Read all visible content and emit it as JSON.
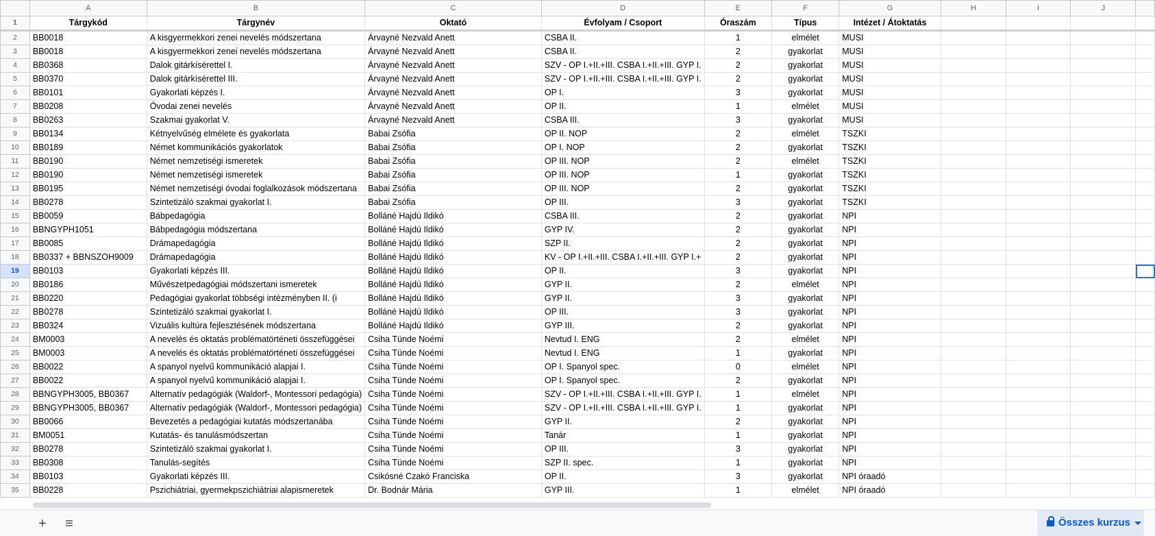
{
  "columns": [
    "A",
    "B",
    "C",
    "D",
    "E",
    "F",
    "G",
    "H",
    "I",
    "J"
  ],
  "header_row": {
    "row": "1",
    "cells": [
      "Tárgykód",
      "Tárgynév",
      "Oktató",
      "Évfolyam / Csoport",
      "Óraszám",
      "Típus",
      "Intézet / Átoktatás"
    ]
  },
  "rows": [
    {
      "n": "2",
      "cells": [
        "BB0018",
        "A kisgyermekkori zenei nevelés módszertana",
        "Árvayné Nezvald Anett",
        "CSBA II.",
        "1",
        "elmélet",
        "MUSI"
      ]
    },
    {
      "n": "3",
      "cells": [
        "BB0018",
        "A kisgyermekkori zenei nevelés módszertana",
        "Árvayné Nezvald Anett",
        "CSBA II.",
        "2",
        "gyakorlat",
        "MUSI"
      ]
    },
    {
      "n": "4",
      "cells": [
        "BB0368",
        "Dalok gitárkísérettel I.",
        "Árvayné Nezvald Anett",
        "SZV - OP I.+II.+III. CSBA I.+II.+III. GYP I.",
        "2",
        "gyakorlat",
        "MUSI"
      ]
    },
    {
      "n": "5",
      "cells": [
        "BB0370",
        "Dalok gitárkísérettel III.",
        "Árvayné Nezvald Anett",
        "SZV - OP I.+II.+III. CSBA I.+II.+III. GYP I.",
        "2",
        "gyakorlat",
        "MUSI"
      ]
    },
    {
      "n": "6",
      "cells": [
        "BB0101",
        "Gyakorlati képzés I.",
        "Árvayné Nezvald Anett",
        "OP I.",
        "3",
        "gyakorlat",
        "MUSI"
      ]
    },
    {
      "n": "7",
      "cells": [
        "BB0208",
        "Óvodai zenei nevelés",
        "Árvayné Nezvald Anett",
        "OP II.",
        "1",
        "elmélet",
        "MUSI"
      ]
    },
    {
      "n": "8",
      "cells": [
        "BB0263",
        "Szakmai gyakorlat V.",
        "Árvayné Nezvald Anett",
        "CSBA III.",
        "3",
        "gyakorlat",
        "MUSI"
      ]
    },
    {
      "n": "9",
      "cells": [
        "BB0134",
        "Kétnyelvűség elmélete és gyakorlata",
        "Babai Zsófia",
        "OP II. NOP",
        "2",
        "elmélet",
        "TSZKI"
      ]
    },
    {
      "n": "10",
      "cells": [
        "BB0189",
        "Német kommunikációs gyakorlatok",
        "Babai Zsófia",
        "OP I. NOP",
        "2",
        "gyakorlat",
        "TSZKI"
      ]
    },
    {
      "n": "11",
      "cells": [
        "BB0190",
        "Német nemzetiségi ismeretek",
        "Babai Zsófia",
        "OP III. NOP",
        "2",
        "elmélet",
        "TSZKI"
      ]
    },
    {
      "n": "12",
      "cells": [
        "BB0190",
        "Német nemzetiségi ismeretek",
        "Babai Zsófia",
        "OP III. NOP",
        "1",
        "gyakorlat",
        "TSZKI"
      ]
    },
    {
      "n": "13",
      "cells": [
        "BB0195",
        "Német nemzetiségi óvodai foglalkozások módszertana",
        "Babai Zsófia",
        "OP III. NOP",
        "2",
        "gyakorlat",
        "TSZKI"
      ]
    },
    {
      "n": "14",
      "cells": [
        "BB0278",
        "Szintetizáló szakmai gyakorlat I.",
        "Babai Zsófia",
        "OP III.",
        "3",
        "gyakorlat",
        "TSZKI"
      ]
    },
    {
      "n": "15",
      "cells": [
        "BB0059",
        "Bábpedagógia",
        "Bolláné Hajdú Ildikó",
        "CSBA III.",
        "2",
        "gyakorlat",
        "NPI"
      ]
    },
    {
      "n": "16",
      "cells": [
        "BBNGYPH1051",
        "Bábpedagógia módszertana",
        "Bolláné Hajdú Ildikó",
        "GYP IV.",
        "2",
        "gyakorlat",
        "NPI"
      ]
    },
    {
      "n": "17",
      "cells": [
        "BB0085",
        "Drámapedagógia",
        "Bolláné Hajdú Ildikó",
        "SZP II.",
        "2",
        "gyakorlat",
        "NPI"
      ]
    },
    {
      "n": "18",
      "cells": [
        "BB0337 + BBNSZOH9009",
        "Drámapedagógia",
        "Bolláné Hajdú Ildikó",
        "KV - OP I.+II.+III. CSBA I.+II.+III. GYP I.+",
        "2",
        "gyakorlat",
        "NPI"
      ]
    },
    {
      "n": "19",
      "cells": [
        "BB0103",
        "Gyakorlati képzés III.",
        "Bolláné Hajdú Ildikó",
        "OP II.",
        "3",
        "gyakorlat",
        "NPI"
      ]
    },
    {
      "n": "20",
      "cells": [
        "BB0186",
        "Művészetpedagógiai módszertani ismeretek",
        "Bolláné Hajdú Ildikó",
        "GYP II.",
        "2",
        "elmélet",
        "NPI"
      ]
    },
    {
      "n": "21",
      "cells": [
        "BB0220",
        "Pedagógiai gyakorlat többségi intézményben II. (i",
        "Bolláné Hajdú Ildikó",
        "GYP II.",
        "3",
        "gyakorlat",
        "NPI"
      ]
    },
    {
      "n": "22",
      "cells": [
        "BB0278",
        "Szintetizáló szakmai gyakorlat I.",
        "Bolláné Hajdú Ildikó",
        "OP III.",
        "3",
        "gyakorlat",
        "NPI"
      ]
    },
    {
      "n": "23",
      "cells": [
        "BB0324",
        "Vizuális kultúra fejlesztésének módszertana",
        "Bolláné Hajdú Ildikó",
        "GYP III.",
        "2",
        "gyakorlat",
        "NPI"
      ]
    },
    {
      "n": "24",
      "cells": [
        "BM0003",
        "A nevelés és oktatás problématörténeti összefüggései",
        "Csiha Tünde Noémi",
        "Nevtud I. ENG",
        "2",
        "elmélet",
        "NPI"
      ]
    },
    {
      "n": "25",
      "cells": [
        "BM0003",
        "A nevelés és oktatás problématörténeti összefüggései",
        "Csiha Tünde Noémi",
        "Nevtud I. ENG",
        "1",
        "gyakorlat",
        "NPI"
      ]
    },
    {
      "n": "26",
      "cells": [
        "BB0022",
        "A spanyol nyelvű kommunikáció alapjai I.",
        "Csiha Tünde Noémi",
        "OP I. Spanyol spec.",
        "0",
        "elmélet",
        "NPI"
      ]
    },
    {
      "n": "27",
      "cells": [
        "BB0022",
        "A spanyol nyelvű kommunikáció alapjai I.",
        "Csiha Tünde Noémi",
        "OP I. Spanyol spec.",
        "2",
        "gyakorlat",
        "NPI"
      ]
    },
    {
      "n": "28",
      "cells": [
        "BBNGYPH3005, BB0367",
        "Alternatív pedagógiák (Waldorf-, Montessori pedagógia)",
        "Csiha Tünde Noémi",
        "SZV - OP I.+II.+III. CSBA I.+II.+III. GYP I.",
        "1",
        "elmélet",
        "NPI"
      ]
    },
    {
      "n": "29",
      "cells": [
        "BBNGYPH3005, BB0367",
        "Alternatív pedagógiák (Waldorf-, Montessori pedagógia)",
        "Csiha Tünde Noémi",
        "SZV - OP I.+II.+III. CSBA I.+II.+III. GYP I.",
        "1",
        "gyakorlat",
        "NPI"
      ]
    },
    {
      "n": "30",
      "cells": [
        "BB0066",
        "Bevezetés a pedagógiai kutatás módszertanába",
        "Csiha Tünde Noémi",
        "GYP II.",
        "2",
        "gyakorlat",
        "NPI"
      ]
    },
    {
      "n": "31",
      "cells": [
        "BM0051",
        "Kutatás- és tanulásmódszertan",
        "Csiha Tünde Noémi",
        "Tanár",
        "1",
        "gyakorlat",
        "NPI"
      ]
    },
    {
      "n": "32",
      "cells": [
        "BB0278",
        "Szintetizáló szakmai gyakorlat I.",
        "Csiha Tünde Noémi",
        "OP III.",
        "3",
        "gyakorlat",
        "NPI"
      ]
    },
    {
      "n": "33",
      "cells": [
        "BB0308",
        "Tanulás-segítés",
        "Csiha Tünde Noémi",
        "SZP II. spec.",
        "1",
        "gyakorlat",
        "NPI"
      ]
    },
    {
      "n": "34",
      "cells": [
        "BB0103",
        "Gyakorlati képzés III.",
        "Csikósné Czakó Franciska",
        "OP II.",
        "3",
        "gyakorlat",
        "NPI óraadó"
      ]
    },
    {
      "n": "35",
      "cells": [
        "BB0228",
        "Pszichiátriai, gyermekpszichiátriai alapismeretek",
        "Dr. Bodnár Mária",
        "GYP III.",
        "1",
        "elmélet",
        "NPI óraadó"
      ]
    }
  ],
  "selected_row": "19",
  "bottom_bar": {
    "add_icon": "+",
    "menu_icon": "≡",
    "tab_label": "Összes kurzus"
  }
}
